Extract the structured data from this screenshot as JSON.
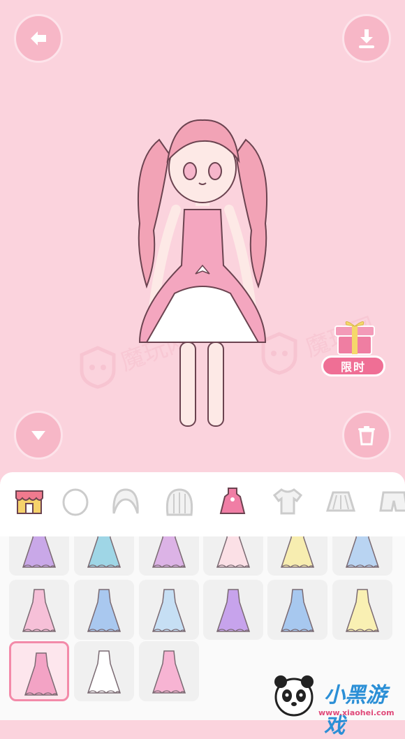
{
  "buttons": {
    "back": "back-arrow-icon",
    "download": "download-icon",
    "collapse": "chevron-down-icon",
    "trash": "trash-icon"
  },
  "limited_offer": {
    "label": "限时",
    "icon": "gift-box-icon"
  },
  "watermark": {
    "text": "魔玩网"
  },
  "tabs": [
    {
      "name": "shop",
      "icon": "shop-icon",
      "selected": false
    },
    {
      "name": "face",
      "icon": "face-icon",
      "selected": false
    },
    {
      "name": "hair-front",
      "icon": "hair-icon",
      "selected": false
    },
    {
      "name": "hair-back",
      "icon": "hair-back-icon",
      "selected": false
    },
    {
      "name": "dress",
      "icon": "dress-icon",
      "selected": true
    },
    {
      "name": "top",
      "icon": "shirt-icon",
      "selected": false
    },
    {
      "name": "skirt",
      "icon": "skirt-icon",
      "selected": false
    },
    {
      "name": "shorts",
      "icon": "shorts-icon",
      "selected": false
    }
  ],
  "items": [
    {
      "name": "dress-purple-skirt",
      "color": "#c9a8e8"
    },
    {
      "name": "dress-blue-skirt",
      "color": "#9fd6e6"
    },
    {
      "name": "dress-lilac",
      "color": "#dcb3e6"
    },
    {
      "name": "dress-white-pink",
      "color": "#fbe0e6"
    },
    {
      "name": "dress-yellow",
      "color": "#f7edb0"
    },
    {
      "name": "dress-blue-pink",
      "color": "#b9d4f2"
    },
    {
      "name": "dress-pink-striped",
      "color": "#f6c0d8"
    },
    {
      "name": "dress-blue-bow",
      "color": "#a9c8ef"
    },
    {
      "name": "dress-light-blue",
      "color": "#c6dff4"
    },
    {
      "name": "dress-purple-gradient",
      "color": "#c7a3ec"
    },
    {
      "name": "dress-blue-gown",
      "color": "#a7c8ef"
    },
    {
      "name": "dress-yellow-gown",
      "color": "#f9f0b3"
    },
    {
      "name": "dress-pink-ruffle",
      "color": "#f3a3c5",
      "selected": true
    },
    {
      "name": "dress-white-gown",
      "color": "#ffffff"
    },
    {
      "name": "dress-pink-gown",
      "color": "#f7b4d3"
    }
  ],
  "logo": {
    "text": "小黑游戏",
    "url": "www.xiaohei.com"
  }
}
